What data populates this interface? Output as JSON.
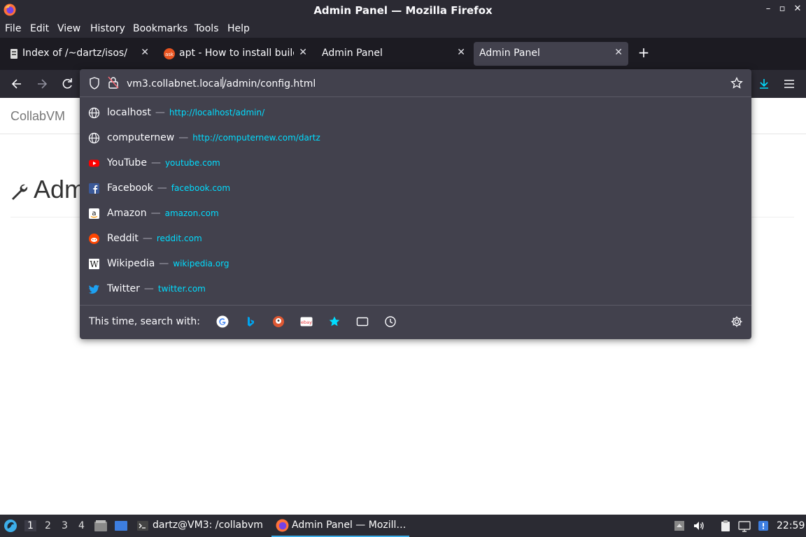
{
  "window": {
    "title": "Admin Panel — Mozilla Firefox"
  },
  "menu": {
    "items": [
      "File",
      "Edit",
      "View",
      "History",
      "Bookmarks",
      "Tools",
      "Help"
    ]
  },
  "tabs": [
    {
      "label": "Index of /~dartz/isos/",
      "active": false
    },
    {
      "label": "apt - How to install build",
      "active": false
    },
    {
      "label": "Admin Panel",
      "active": false
    },
    {
      "label": "Admin Panel",
      "active": true
    }
  ],
  "urlbar": {
    "url_before_caret": "vm3.collabnet.local",
    "url_after_caret": "/admin/config.html"
  },
  "suggestions": [
    {
      "title": "localhost",
      "url": "http://localhost/admin/",
      "icon": "globe-icon"
    },
    {
      "title": "computernew",
      "url": "http://computernew.com/dartz",
      "icon": "globe-icon"
    },
    {
      "title": "YouTube",
      "url": "youtube.com",
      "icon": "youtube-icon"
    },
    {
      "title": "Facebook",
      "url": "facebook.com",
      "icon": "facebook-icon"
    },
    {
      "title": "Amazon",
      "url": "amazon.com",
      "icon": "amazon-icon"
    },
    {
      "title": "Reddit",
      "url": "reddit.com",
      "icon": "reddit-icon"
    },
    {
      "title": "Wikipedia",
      "url": "wikipedia.org",
      "icon": "wikipedia-icon"
    },
    {
      "title": "Twitter",
      "url": "twitter.com",
      "icon": "twitter-icon"
    }
  ],
  "search_with": {
    "label": "This time, search with:"
  },
  "page": {
    "brand": "CollabVM",
    "heading": "Adm"
  },
  "taskbar": {
    "workspaces": [
      "1",
      "2",
      "3",
      "4"
    ],
    "terminal_label": "dartz@VM3: /collabvm",
    "firefox_label": "Admin Panel — Mozill…",
    "clock": "22:59"
  },
  "colors": {
    "accent": "#00ddff",
    "panel": "#42414d",
    "toolbar": "#2b2a33"
  }
}
